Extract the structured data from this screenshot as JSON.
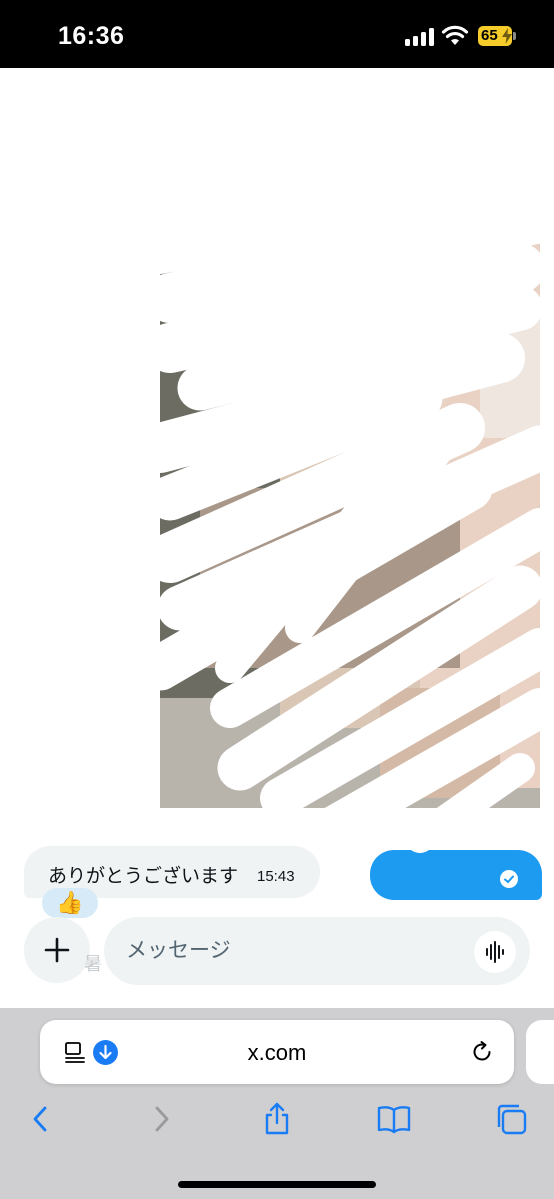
{
  "status_bar": {
    "time": "16:36",
    "battery_level": "65"
  },
  "chat": {
    "received_message": "ありがとうございます",
    "received_time": "15:43",
    "reaction": "👍"
  },
  "composer": {
    "placeholder": "メッセージ",
    "hint_char": "暑"
  },
  "browser": {
    "url": "x.com"
  },
  "icons": {
    "signal": "cellular-signal-icon",
    "wifi": "wifi-icon",
    "battery": "battery-charging-icon",
    "read": "read-receipt-icon",
    "add": "plus-icon",
    "voice": "voice-waveform-icon",
    "reader": "reader-mode-icon",
    "download": "download-icon",
    "reload": "reload-icon",
    "back": "back-chevron-icon",
    "forward": "forward-chevron-icon",
    "share": "share-icon",
    "bookmarks": "bookmarks-icon",
    "tabs": "tabs-icon"
  },
  "colors": {
    "accent": "#1d9bf0",
    "safari_blue": "#1a7cf5",
    "battery": "#f5cc2a"
  }
}
